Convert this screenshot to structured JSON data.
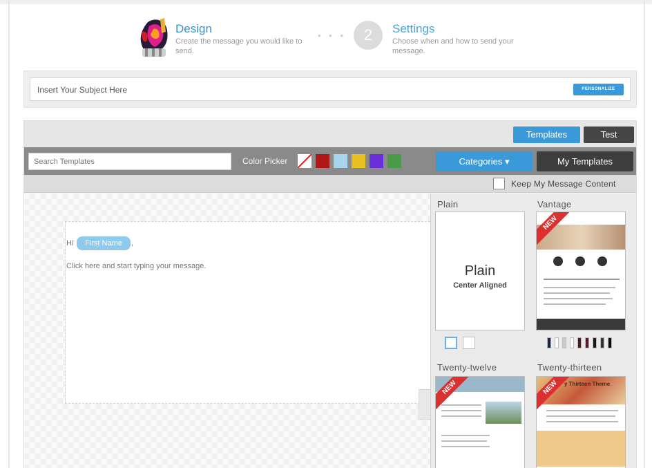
{
  "steps": {
    "step1": {
      "title": "Design",
      "description": "Create the message you would like to send."
    },
    "dots": "• • •",
    "step2": {
      "number": "2",
      "title": "Settings",
      "description": "Choose when and how to send your message."
    }
  },
  "subject": {
    "placeholder": "Insert Your Subject Here",
    "personalize_label": "PERSONALIZE"
  },
  "tabs": {
    "templates": "Templates",
    "test": "Test"
  },
  "toolbar": {
    "search_placeholder": "Search Templates",
    "color_picker_label": "Color Picker",
    "swatches": [
      "#b01818",
      "#a8d4ee",
      "#e8c020",
      "#6a2fd8",
      "#4a9a4a"
    ],
    "categories_label": "Categories ▾",
    "my_templates_label": "My Templates"
  },
  "keep_content_label": "Keep My Message Content",
  "editor": {
    "greeting": "Hi",
    "first_name_token": "First Name",
    "comma": ",",
    "body_prompt": "Click here and start typing your message."
  },
  "templates": [
    {
      "name": "Plain",
      "thumb_title": "Plain",
      "thumb_subtitle": "Center Aligned"
    },
    {
      "name": "Vantage",
      "badge": "NEW"
    },
    {
      "name": "Twenty-twelve",
      "badge": "NEW"
    },
    {
      "name": "Twenty-thirteen",
      "badge": "NEW",
      "thumb_title": "y Thirteen Theme"
    }
  ],
  "vantage_stripes": [
    "#1a2a3a",
    "#ffffff",
    "#cccccc",
    "#ffffff",
    "#4a1a1a",
    "#5a1a2a",
    "#1a1a1a",
    "#333333",
    "#0a0a0a"
  ]
}
